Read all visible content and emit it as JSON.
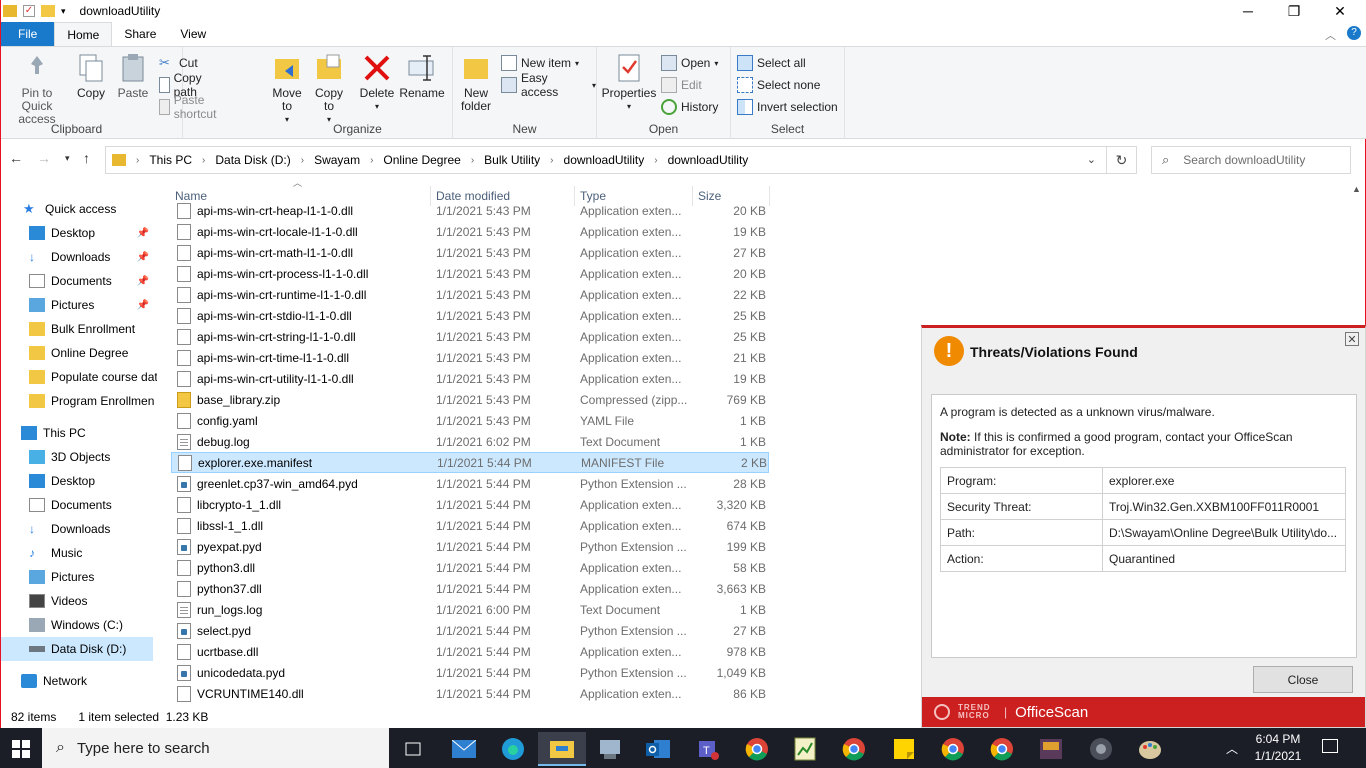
{
  "window": {
    "title": "downloadUtility",
    "minimize": "─",
    "maximize": "❐",
    "close": "✕"
  },
  "ribbon_tabs": [
    "File",
    "Home",
    "Share",
    "View"
  ],
  "ribbon": {
    "clipboard": {
      "label": "Clipboard",
      "pin": "Pin to Quick access",
      "copy": "Copy",
      "paste": "Paste",
      "cut": "Cut",
      "copy_path": "Copy path",
      "paste_shortcut": "Paste shortcut"
    },
    "organize": {
      "label": "Organize",
      "move_to": "Move to",
      "copy_to": "Copy to",
      "delete": "Delete",
      "rename": "Rename"
    },
    "new": {
      "label": "New",
      "new_folder": "New folder",
      "new_item": "New item",
      "easy_access": "Easy access"
    },
    "open": {
      "label": "Open",
      "properties": "Properties",
      "open": "Open",
      "edit": "Edit",
      "history": "History"
    },
    "select": {
      "label": "Select",
      "select_all": "Select all",
      "select_none": "Select none",
      "invert": "Invert selection"
    }
  },
  "address": {
    "crumbs": [
      "This PC",
      "Data Disk (D:)",
      "Swayam",
      "Online Degree",
      "Bulk Utility",
      "downloadUtility",
      "downloadUtility"
    ],
    "search_placeholder": "Search downloadUtility"
  },
  "nav": {
    "quick_access": "Quick access",
    "quick_items": [
      "Desktop",
      "Downloads",
      "Documents",
      "Pictures",
      "Bulk Enrollment",
      "Online Degree",
      "Populate course dat",
      "Program Enrollmen"
    ],
    "this_pc": "This PC",
    "pc_items": [
      "3D Objects",
      "Desktop",
      "Documents",
      "Downloads",
      "Music",
      "Pictures",
      "Videos",
      "Windows (C:)",
      "Data Disk (D:)"
    ],
    "network": "Network"
  },
  "columns": {
    "name": "Name",
    "date": "Date modified",
    "type": "Type",
    "size": "Size"
  },
  "files": [
    {
      "name": "api-ms-win-crt-heap-l1-1-0.dll",
      "date": "1/1/2021 5:43 PM",
      "type": "Application exten...",
      "size": "20 KB",
      "icon": "file"
    },
    {
      "name": "api-ms-win-crt-locale-l1-1-0.dll",
      "date": "1/1/2021 5:43 PM",
      "type": "Application exten...",
      "size": "19 KB",
      "icon": "file"
    },
    {
      "name": "api-ms-win-crt-math-l1-1-0.dll",
      "date": "1/1/2021 5:43 PM",
      "type": "Application exten...",
      "size": "27 KB",
      "icon": "file"
    },
    {
      "name": "api-ms-win-crt-process-l1-1-0.dll",
      "date": "1/1/2021 5:43 PM",
      "type": "Application exten...",
      "size": "20 KB",
      "icon": "file"
    },
    {
      "name": "api-ms-win-crt-runtime-l1-1-0.dll",
      "date": "1/1/2021 5:43 PM",
      "type": "Application exten...",
      "size": "22 KB",
      "icon": "file"
    },
    {
      "name": "api-ms-win-crt-stdio-l1-1-0.dll",
      "date": "1/1/2021 5:43 PM",
      "type": "Application exten...",
      "size": "25 KB",
      "icon": "file"
    },
    {
      "name": "api-ms-win-crt-string-l1-1-0.dll",
      "date": "1/1/2021 5:43 PM",
      "type": "Application exten...",
      "size": "25 KB",
      "icon": "file"
    },
    {
      "name": "api-ms-win-crt-time-l1-1-0.dll",
      "date": "1/1/2021 5:43 PM",
      "type": "Application exten...",
      "size": "21 KB",
      "icon": "file"
    },
    {
      "name": "api-ms-win-crt-utility-l1-1-0.dll",
      "date": "1/1/2021 5:43 PM",
      "type": "Application exten...",
      "size": "19 KB",
      "icon": "file"
    },
    {
      "name": "base_library.zip",
      "date": "1/1/2021 5:43 PM",
      "type": "Compressed (zipp...",
      "size": "769 KB",
      "icon": "zip"
    },
    {
      "name": "config.yaml",
      "date": "1/1/2021 5:43 PM",
      "type": "YAML File",
      "size": "1 KB",
      "icon": "file"
    },
    {
      "name": "debug.log",
      "date": "1/1/2021 6:02 PM",
      "type": "Text Document",
      "size": "1 KB",
      "icon": "txt"
    },
    {
      "name": "explorer.exe.manifest",
      "date": "1/1/2021 5:44 PM",
      "type": "MANIFEST File",
      "size": "2 KB",
      "icon": "file"
    },
    {
      "name": "greenlet.cp37-win_amd64.pyd",
      "date": "1/1/2021 5:44 PM",
      "type": "Python Extension ...",
      "size": "28 KB",
      "icon": "py"
    },
    {
      "name": "libcrypto-1_1.dll",
      "date": "1/1/2021 5:44 PM",
      "type": "Application exten...",
      "size": "3,320 KB",
      "icon": "file"
    },
    {
      "name": "libssl-1_1.dll",
      "date": "1/1/2021 5:44 PM",
      "type": "Application exten...",
      "size": "674 KB",
      "icon": "file"
    },
    {
      "name": "pyexpat.pyd",
      "date": "1/1/2021 5:44 PM",
      "type": "Python Extension ...",
      "size": "199 KB",
      "icon": "py"
    },
    {
      "name": "python3.dll",
      "date": "1/1/2021 5:44 PM",
      "type": "Application exten...",
      "size": "58 KB",
      "icon": "file"
    },
    {
      "name": "python37.dll",
      "date": "1/1/2021 5:44 PM",
      "type": "Application exten...",
      "size": "3,663 KB",
      "icon": "file"
    },
    {
      "name": "run_logs.log",
      "date": "1/1/2021 6:00 PM",
      "type": "Text Document",
      "size": "1 KB",
      "icon": "txt"
    },
    {
      "name": "select.pyd",
      "date": "1/1/2021 5:44 PM",
      "type": "Python Extension ...",
      "size": "27 KB",
      "icon": "py"
    },
    {
      "name": "ucrtbase.dll",
      "date": "1/1/2021 5:44 PM",
      "type": "Application exten...",
      "size": "978 KB",
      "icon": "file"
    },
    {
      "name": "unicodedata.pyd",
      "date": "1/1/2021 5:44 PM",
      "type": "Python Extension ...",
      "size": "1,049 KB",
      "icon": "py"
    },
    {
      "name": "VCRUNTIME140.dll",
      "date": "1/1/2021 5:44 PM",
      "type": "Application exten...",
      "size": "86 KB",
      "icon": "file"
    }
  ],
  "status": {
    "count": "82 items",
    "selected": "1 item selected  1.23 KB"
  },
  "dialog": {
    "title": "Threats/Violations Found",
    "message": "A program is detected as a unknown virus/malware.",
    "note_label": "Note:",
    "note_text": " If this is confirmed a good program, contact your OfficeScan administrator for exception.",
    "rows": [
      {
        "key": "Program:",
        "value": "explorer.exe"
      },
      {
        "key": "Security Threat:",
        "value": "Troj.Win32.Gen.XXBM100FF011R0001"
      },
      {
        "key": "Path:",
        "value": "D:\\Swayam\\Online Degree\\Bulk Utility\\do..."
      },
      {
        "key": "Action:",
        "value": "Quarantined"
      }
    ],
    "close_button": "Close",
    "brand_small": "TREND MICRO",
    "brand": "OfficeScan"
  },
  "taskbar": {
    "search_placeholder": "Type here to search",
    "time": "6:04 PM",
    "date": "1/1/2021"
  },
  "colors": {
    "accent": "#1979ca",
    "selection": "#cce8ff",
    "trend_red": "#cc1f1f",
    "taskbar": "#1b1e27"
  }
}
